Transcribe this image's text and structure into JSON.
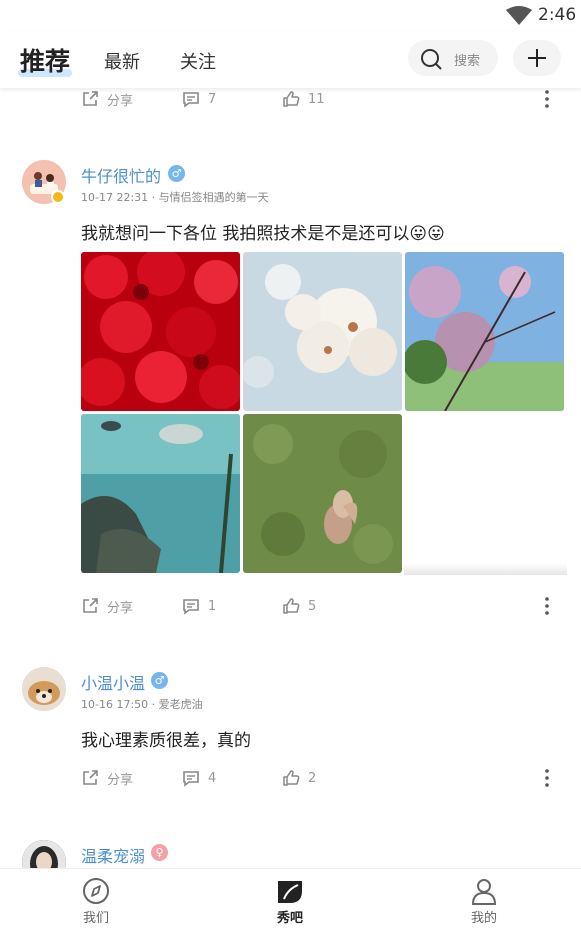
{
  "status_bar": {
    "time": "2:46"
  },
  "header": {
    "tabs": [
      {
        "label": "推荐"
      },
      {
        "label": "最新"
      },
      {
        "label": "关注"
      }
    ],
    "search_placeholder": "搜索"
  },
  "top_actions": {
    "share_label": "分享",
    "comments": "7",
    "likes": "11"
  },
  "posts": [
    {
      "username": "牛仔很忙的",
      "gender": "male",
      "meta": "10-17 22:31 · 与情侣签相遇的第一天",
      "content": "我就想问一下各位  我拍照技术是不是还可以😛😛",
      "photos": [
        "red-flowers",
        "cherry-blossoms",
        "pink-blossom-tree",
        "aquarium-fish",
        "squirrel-on-grass"
      ],
      "actions": {
        "share_label": "分享",
        "comments": "1",
        "likes": "5"
      }
    },
    {
      "username": "小温小温",
      "gender": "male",
      "meta": "10-16 17:50 · 爱老虎油",
      "content": "我心理素质很差，真的",
      "actions": {
        "share_label": "分享",
        "comments": "4",
        "likes": "2"
      }
    },
    {
      "username": "温柔宠溺",
      "gender": "female"
    }
  ],
  "bottom_nav": [
    {
      "label": "我们",
      "icon": "compass-icon"
    },
    {
      "label": "秀吧",
      "icon": "leaf-icon",
      "active": true
    },
    {
      "label": "我的",
      "icon": "user-icon"
    }
  ],
  "colors": {
    "username": "#4a8fd0",
    "male_badge": "#74b6ef",
    "female_badge": "#f4a0a8",
    "verified_badge": "#f5b915",
    "tab_underline": "#cfe6ff"
  }
}
